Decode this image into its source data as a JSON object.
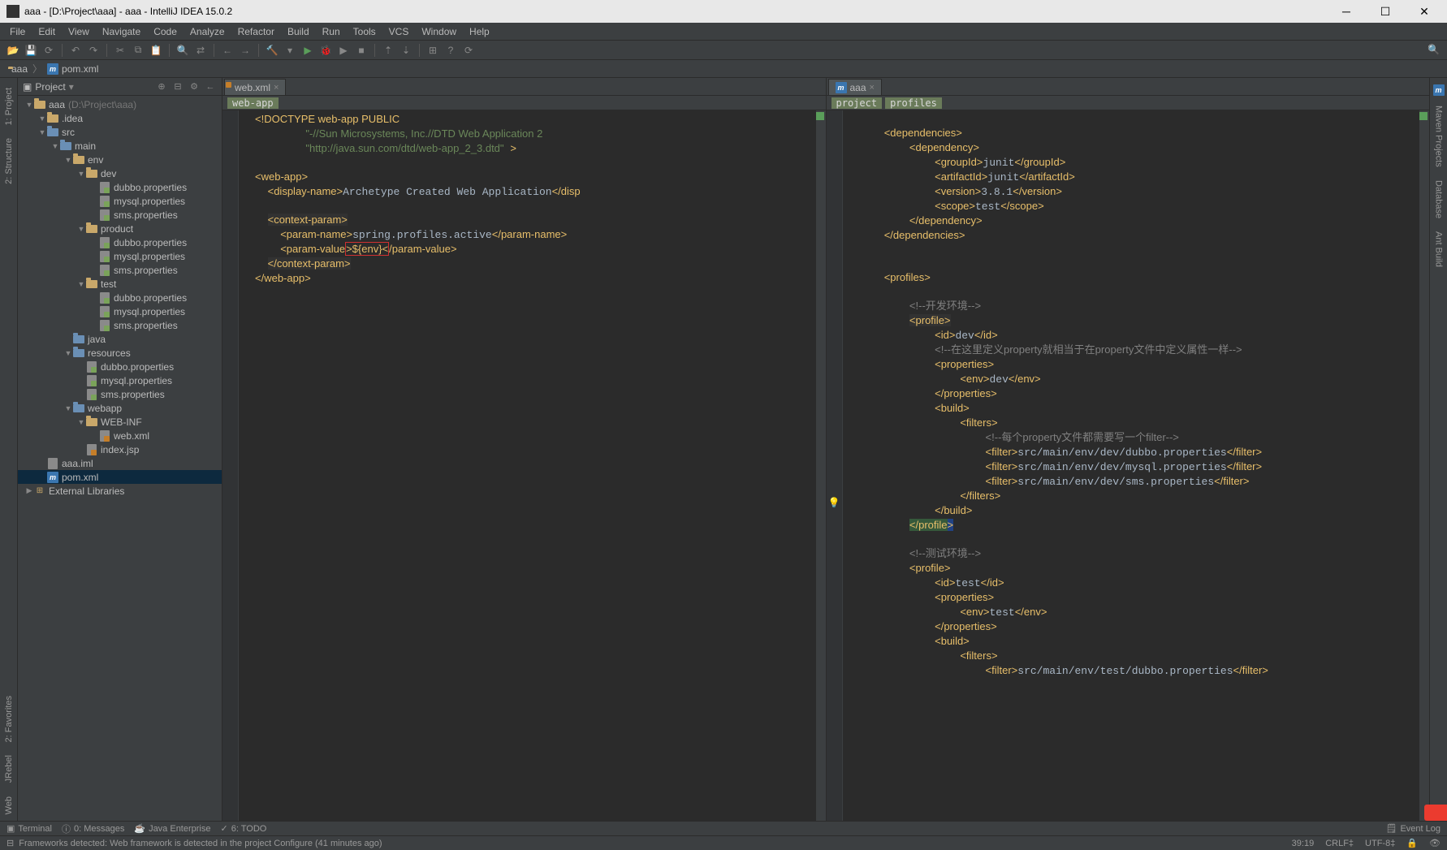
{
  "titlebar": {
    "title": "aaa - [D:\\Project\\aaa] - aaa - IntelliJ IDEA 15.0.2"
  },
  "menubar": [
    "File",
    "Edit",
    "View",
    "Navigate",
    "Code",
    "Analyze",
    "Refactor",
    "Build",
    "Run",
    "Tools",
    "VCS",
    "Window",
    "Help"
  ],
  "breadcrumb": {
    "items": [
      {
        "icon": "folder",
        "label": "aaa"
      },
      {
        "icon": "m",
        "label": "pom.xml"
      }
    ]
  },
  "project_panel": {
    "title": "Project",
    "tree": [
      {
        "depth": 0,
        "arrow": "▼",
        "icon": "folder",
        "name": "aaa",
        "path": "(D:\\Project\\aaa)"
      },
      {
        "depth": 1,
        "arrow": "▼",
        "icon": "folder",
        "name": ".idea"
      },
      {
        "depth": 1,
        "arrow": "▼",
        "icon": "folder-blue",
        "name": "src"
      },
      {
        "depth": 2,
        "arrow": "▼",
        "icon": "folder-blue",
        "name": "main"
      },
      {
        "depth": 3,
        "arrow": "▼",
        "icon": "folder",
        "name": "env"
      },
      {
        "depth": 4,
        "arrow": "▼",
        "icon": "folder",
        "name": "dev"
      },
      {
        "depth": 5,
        "arrow": "",
        "icon": "file-prop",
        "name": "dubbo.properties"
      },
      {
        "depth": 5,
        "arrow": "",
        "icon": "file-prop",
        "name": "mysql.properties"
      },
      {
        "depth": 5,
        "arrow": "",
        "icon": "file-prop",
        "name": "sms.properties"
      },
      {
        "depth": 4,
        "arrow": "▼",
        "icon": "folder",
        "name": "product"
      },
      {
        "depth": 5,
        "arrow": "",
        "icon": "file-prop",
        "name": "dubbo.properties"
      },
      {
        "depth": 5,
        "arrow": "",
        "icon": "file-prop",
        "name": "mysql.properties"
      },
      {
        "depth": 5,
        "arrow": "",
        "icon": "file-prop",
        "name": "sms.properties"
      },
      {
        "depth": 4,
        "arrow": "▼",
        "icon": "folder",
        "name": "test"
      },
      {
        "depth": 5,
        "arrow": "",
        "icon": "file-prop",
        "name": "dubbo.properties"
      },
      {
        "depth": 5,
        "arrow": "",
        "icon": "file-prop",
        "name": "mysql.properties"
      },
      {
        "depth": 5,
        "arrow": "",
        "icon": "file-prop",
        "name": "sms.properties"
      },
      {
        "depth": 3,
        "arrow": "",
        "icon": "folder-blue",
        "name": "java"
      },
      {
        "depth": 3,
        "arrow": "▼",
        "icon": "folder-blue",
        "name": "resources"
      },
      {
        "depth": 4,
        "arrow": "",
        "icon": "file-prop",
        "name": "dubbo.properties"
      },
      {
        "depth": 4,
        "arrow": "",
        "icon": "file-prop",
        "name": "mysql.properties"
      },
      {
        "depth": 4,
        "arrow": "",
        "icon": "file-prop",
        "name": "sms.properties"
      },
      {
        "depth": 3,
        "arrow": "▼",
        "icon": "folder-blue",
        "name": "webapp"
      },
      {
        "depth": 4,
        "arrow": "▼",
        "icon": "folder",
        "name": "WEB-INF"
      },
      {
        "depth": 5,
        "arrow": "",
        "icon": "file-xml",
        "name": "web.xml"
      },
      {
        "depth": 4,
        "arrow": "",
        "icon": "file-xml",
        "name": "index.jsp"
      },
      {
        "depth": 1,
        "arrow": "",
        "icon": "file",
        "name": "aaa.iml"
      },
      {
        "depth": 1,
        "arrow": "",
        "icon": "m",
        "name": "pom.xml",
        "selected": true
      },
      {
        "depth": 0,
        "arrow": "▶",
        "icon": "lib",
        "name": "External Libraries"
      }
    ]
  },
  "left_editor": {
    "tab": {
      "label": "web.xml"
    },
    "crumbs": [
      "web-app"
    ],
    "code": "<!DOCTYPE web-app PUBLIC\n        \"-//Sun Microsystems, Inc.//DTD Web Application 2\n        \"http://java.sun.com/dtd/web-app_2_3.dtd\" >\n\n<web-app>\n  <display-name>Archetype Created Web Application</disp\n\n  <context-param>\n    <param-name>spring.profiles.active</param-name>\n    <param-value>${env}</param-value>\n  </context-param>\n</web-app>"
  },
  "right_editor": {
    "tab": {
      "label": "aaa"
    },
    "crumbs": [
      "project",
      "profiles"
    ],
    "code_lines": [
      "",
      "    <dependencies>",
      "        <dependency>",
      "            <groupId>junit</groupId>",
      "            <artifactId>junit</artifactId>",
      "            <version>3.8.1</version>",
      "            <scope>test</scope>",
      "        </dependency>",
      "    </dependencies>",
      "",
      "",
      "    <profiles>",
      "",
      "        <!--开发环境-->",
      "        <profile>",
      "            <id>dev</id>",
      "            <!--在这里定义property就相当于在property文件中定义属性一样-->",
      "            <properties>",
      "                <env>dev</env>",
      "            </properties>",
      "            <build>",
      "                <filters>",
      "                    <!--每个property文件都需要写一个filter-->",
      "                    <filter>src/main/env/dev/dubbo.properties</filter>",
      "                    <filter>src/main/env/dev/mysql.properties</filter>",
      "                    <filter>src/main/env/dev/sms.properties</filter>",
      "                </filters>",
      "            </build>",
      "        </profile>",
      "",
      "        <!--测试环境-->",
      "        <profile>",
      "            <id>test</id>",
      "            <properties>",
      "                <env>test</env>",
      "            </properties>",
      "            <build>",
      "                <filters>",
      "                    <filter>src/main/env/test/dubbo.properties</filter>"
    ]
  },
  "left_tabs": [
    "1: Project",
    "2: Structure",
    "2: Favorites",
    "JRebel",
    "Web"
  ],
  "right_tabs": [
    "Maven Projects",
    "Database",
    "Ant Build"
  ],
  "bottom_tabs": [
    "Terminal",
    "0: Messages",
    "Java Enterprise",
    "6: TODO"
  ],
  "bottom_right": "Event Log",
  "status": {
    "msg": "Frameworks detected: Web framework is detected in the project Configure (41 minutes ago)",
    "pos": "39:19",
    "lineend": "CRLF‡",
    "enc": "UTF-8‡",
    "lock": "🔒"
  }
}
